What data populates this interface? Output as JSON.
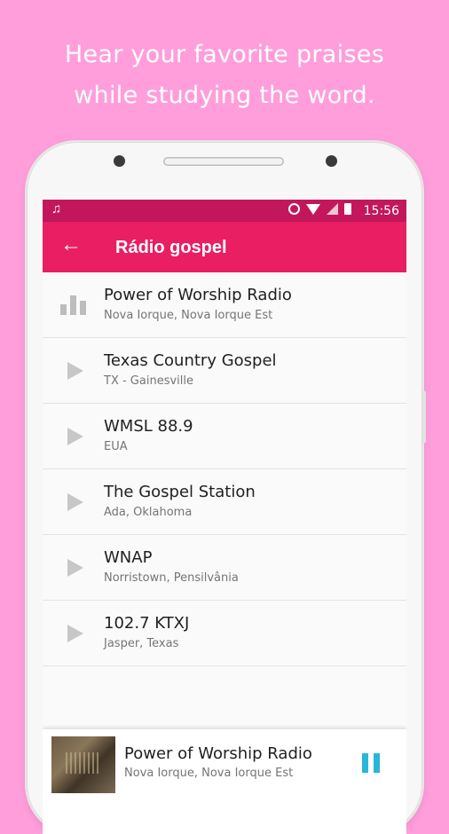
{
  "promo": {
    "line1": "Hear your favorite praises",
    "line2": "while studying the word."
  },
  "status_bar": {
    "music_icon": "♫",
    "time": "15:56"
  },
  "app_bar": {
    "back_icon": "←",
    "title": "Rádio gospel"
  },
  "stations": [
    {
      "name": "Power of Worship Radio",
      "location": "Nova Iorque, Nova Iorque Est",
      "icon": "equalizer-icon"
    },
    {
      "name": "Texas Country Gospel",
      "location": "TX - Gainesville",
      "icon": "play-icon"
    },
    {
      "name": "WMSL 88.9",
      "location": "EUA",
      "icon": "play-icon"
    },
    {
      "name": "The Gospel Station",
      "location": "Ada, Oklahoma",
      "icon": "play-icon"
    },
    {
      "name": "WNAP",
      "location": "Norristown, Pensilvânia",
      "icon": "play-icon"
    },
    {
      "name": "102.7 KTXJ",
      "location": "Jasper, Texas",
      "icon": "play-icon"
    }
  ],
  "now_playing": {
    "name": "Power of Worship Radio",
    "location": "Nova Iorque, Nova Iorque Est"
  },
  "colors": {
    "background": "#ff9edb",
    "status_bar": "#c2185b",
    "app_bar": "#e91e63",
    "pause_icon": "#29b6d8"
  }
}
